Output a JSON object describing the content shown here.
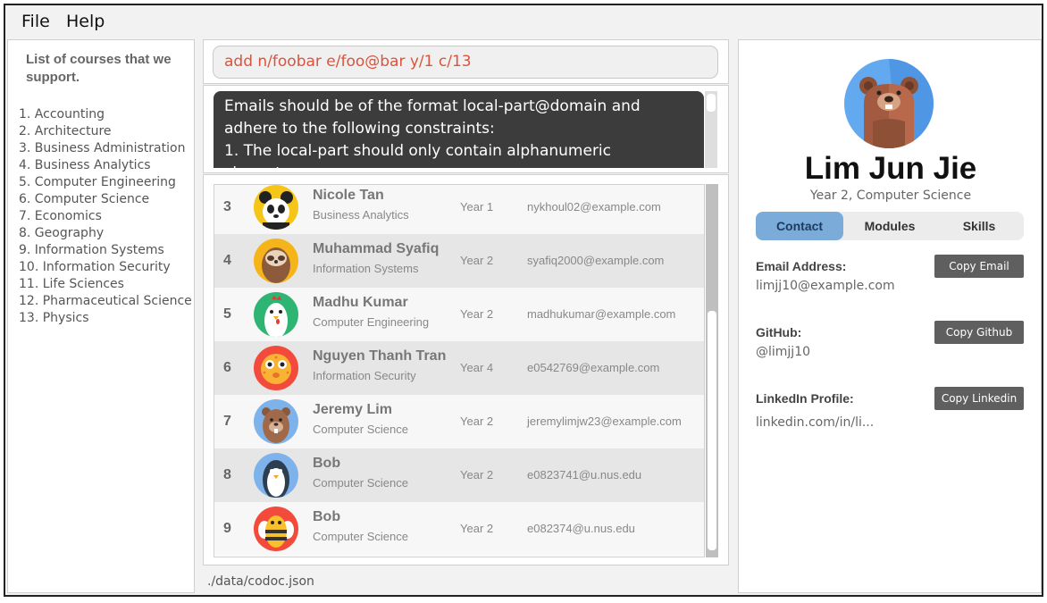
{
  "menu": {
    "file": "File",
    "help": "Help"
  },
  "courses": {
    "title": "List of courses that we support.",
    "items": [
      "1. Accounting",
      "2. Architecture",
      "3. Business Administration",
      "4. Business Analytics",
      "5. Computer Engineering",
      "6. Computer Science",
      "7. Economics",
      "8. Geography",
      "9. Information Systems",
      "10. Information Security",
      "11. Life Sciences",
      "12. Pharmaceutical Science",
      "13. Physics"
    ]
  },
  "command": {
    "value": "add n/foobar e/foo@bar y/1 c/13"
  },
  "result": {
    "text": "Emails should be of the format local-part@domain and adhere to the following constraints:\n1. The local-part should only contain alphanumeric characters"
  },
  "students": [
    {
      "index": "3",
      "name": "Nicole Tan",
      "course": "Business Analytics",
      "year": "Year 1",
      "email": "nykhoul02@example.com",
      "avatar": "panda-avatar-icon"
    },
    {
      "index": "4",
      "name": "Muhammad Syafiq",
      "course": "Information Systems",
      "year": "Year 2",
      "email": "syafiq2000@example.com",
      "avatar": "sloth-avatar-icon"
    },
    {
      "index": "5",
      "name": "Madhu Kumar",
      "course": "Computer Engineering",
      "year": "Year 2",
      "email": "madhukumar@example.com",
      "avatar": "chicken-avatar-icon"
    },
    {
      "index": "6",
      "name": "Nguyen Thanh Tran",
      "course": "Information Security",
      "year": "Year 4",
      "email": "e0542769@example.com",
      "avatar": "pufferfish-avatar-icon"
    },
    {
      "index": "7",
      "name": "Jeremy Lim",
      "course": "Computer Science",
      "year": "Year 2",
      "email": "jeremylimjw23@example.com",
      "avatar": "beaver-avatar-icon"
    },
    {
      "index": "8",
      "name": "Bob",
      "course": "Computer Science",
      "year": "Year 2",
      "email": "e0823741@u.nus.edu",
      "avatar": "penguin-avatar-icon"
    },
    {
      "index": "9",
      "name": "Bob",
      "course": "Computer Science",
      "year": "Year 2",
      "email": "e082374@u.nus.edu",
      "avatar": "bee-avatar-icon"
    }
  ],
  "status": {
    "path": "./data/codoc.json"
  },
  "profile": {
    "name": "Lim Jun Jie",
    "subtitle": "Year 2, Computer Science",
    "avatar": "bear-avatar-icon",
    "tabs": [
      "Contact",
      "Modules",
      "Skills"
    ],
    "active_tab": "Contact",
    "email_label": "Email Address:",
    "email_value": "limjj10@example.com",
    "copy_email": "Copy Email",
    "github_label": "GitHub:",
    "github_value": "@limjj10",
    "copy_github": "Copy Github",
    "linkedin_label": "LinkedIn Profile:",
    "linkedin_value": "linkedin.com/in/li...",
    "copy_linkedin": "Copy Linkedin"
  },
  "colors": {
    "command_text": "#d9543d",
    "result_bg": "#3c3c3c",
    "active_tab": "#7aabd9",
    "button_bg": "#5f5f5f"
  }
}
